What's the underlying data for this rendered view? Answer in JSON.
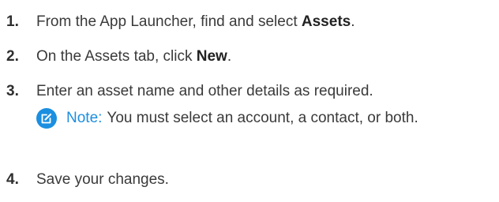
{
  "steps": [
    {
      "number": "1.",
      "text_before": "From the App Launcher, find and select ",
      "bold": "Assets",
      "text_after": "."
    },
    {
      "number": "2.",
      "text_before": "On the Assets tab, click ",
      "bold": "New",
      "text_after": "."
    },
    {
      "number": "3.",
      "text_before": "Enter an asset name and other details as required.",
      "bold": "",
      "text_after": ""
    },
    {
      "number": "4.",
      "text_before": "Save your changes.",
      "bold": "",
      "text_after": ""
    }
  ],
  "note": {
    "icon": "edit-note-icon",
    "label": "Note:",
    "text": "You must select an account, a contact, or both."
  },
  "colors": {
    "note_accent": "#1d8ee0",
    "text": "#3a3a3a"
  }
}
